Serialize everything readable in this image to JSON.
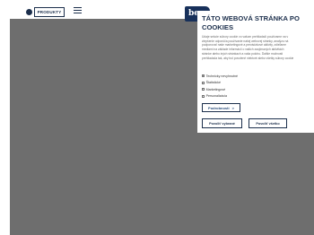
{
  "header": {
    "products_label": "PRODUKTY",
    "logo_text": "be"
  },
  "cookie_dialog": {
    "title_line1": "TÁTO WEBOVÁ STRÁNKA PO",
    "title_line2": "COOKIES",
    "description_lines": [
      "Údaje sekcie súbory cookie vo vašom prehliadači používame na v",
      "zlepšenie odporúča používanie našej webovej stránky, analýzu ná",
      "podporovať naše marketingové a prevádzkové aktivity, zdieľame",
      "mediami na základe informácií o vašich zaujímavých aktivitách",
      "stránke alebo iných stránkach a vaša polohu. Ďalšie možnosti",
      "prehliadača tak, aby bol povolené niektoré alebo všetky súbory cookie"
    ],
    "options": [
      {
        "label": "Technicky nevyhnutné",
        "checked": true
      },
      {
        "label": "Štatistické",
        "checked": false
      },
      {
        "label": "Marketingové",
        "checked": false
      },
      {
        "label": "Personalizácia",
        "checked": false
      }
    ],
    "details_label": "Podrobnosti",
    "details_arrow": ">",
    "allow_selected_label": "Povoliť vybrané",
    "allow_all_label": "Povoliť všetko"
  },
  "colors": {
    "accent": "#1c2f4c",
    "overlay": "#6f6f6f",
    "logo": "#17305a"
  }
}
